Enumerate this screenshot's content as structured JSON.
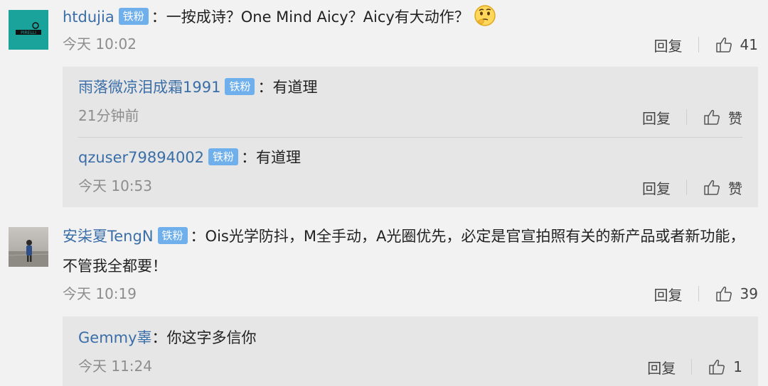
{
  "comments": [
    {
      "user": "htdujia",
      "badge": "铁粉",
      "text": "：一按成诗？One Mind Aicy？Aicy有大动作？",
      "time": "今天 10:02",
      "reply_label": "回复",
      "likes": "41",
      "emoji_icon": "thinking-face-emoji",
      "avatar_icon": "inter-pirelli-logo",
      "replies": [
        {
          "user": "雨落微凉泪成霜1991",
          "badge": "铁粉",
          "text": "：有道理",
          "time": "21分钟前",
          "reply_label": "回复",
          "like_label": "赞"
        },
        {
          "user": "qzuser79894002",
          "badge": "铁粉",
          "text": "：有道理",
          "time": "今天 10:53",
          "reply_label": "回复",
          "like_label": "赞"
        }
      ]
    },
    {
      "user": "安柒夏TengN",
      "badge": "铁粉",
      "text": "：Ois光学防抖，M全手动，A光圈优先，必定是官宣拍照有关的新产品或者新功能，不管我全都要！",
      "time": "今天 10:19",
      "reply_label": "回复",
      "likes": "39",
      "avatar_icon": "person-photo-avatar",
      "replies": [
        {
          "user": "Gemmy辜",
          "text": "：你这字多信你",
          "time": "今天 11:24",
          "reply_label": "回复",
          "likes": "1"
        }
      ]
    }
  ],
  "colors": {
    "background": "#f2f2f2",
    "reply_background": "#e6e6e6",
    "username": "#3a6ea8",
    "badge": "#6fb0ec",
    "time": "#8d8d8d"
  }
}
